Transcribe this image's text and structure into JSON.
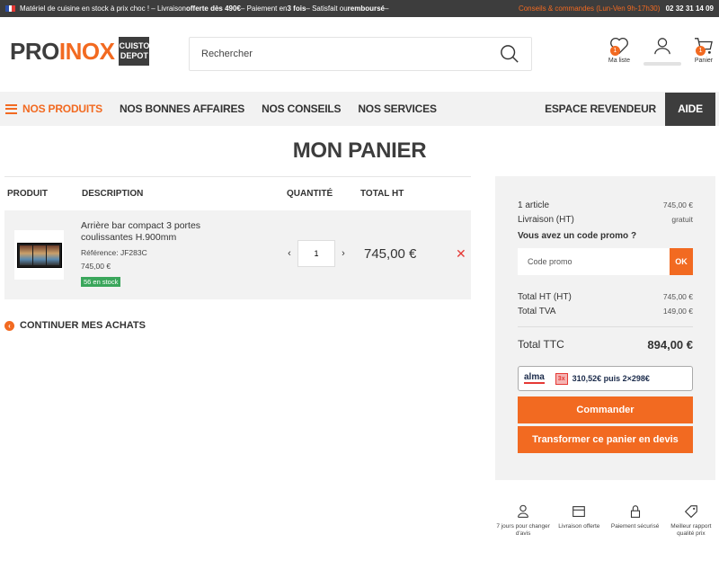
{
  "topbar": {
    "message_parts": [
      "Matériel de cuisine en stock à prix choc ! – Livraison ",
      "offerte dès 490€",
      " – Paiement en ",
      "3 fois",
      " – Satisfait ou ",
      "remboursé",
      " –"
    ],
    "contact": "Conseils & commandes (Lun-Ven 9h-17h30)",
    "phone": "02 32 31 14 09"
  },
  "logo": {
    "pro": "PRO",
    "inox": "INOX",
    "badge_line1": "CUISTO",
    "badge_line2": "DEPOT"
  },
  "search": {
    "placeholder": "Rechercher"
  },
  "header_icons": {
    "wishlist_label": "Ma liste",
    "wishlist_count": "1",
    "cart_label": "Panier",
    "cart_count": "1"
  },
  "nav": {
    "products": "NOS PRODUITS",
    "deals": "NOS BONNES AFFAIRES",
    "advice": "NOS CONSEILS",
    "services": "NOS SERVICES",
    "reseller": "ESPACE REVENDEUR",
    "help": "AIDE"
  },
  "page_title": "MON PANIER",
  "cart": {
    "headers": {
      "product": "PRODUIT",
      "description": "DESCRIPTION",
      "quantity": "QUANTITÉ",
      "total": "TOTAL HT"
    },
    "items": [
      {
        "name": "Arrière bar compact 3 portes coulissantes H.900mm",
        "reference": "Référence: JF283C",
        "unit_price": "745,00 €",
        "stock": "56 en stock",
        "quantity": "1",
        "total": "745,00 €"
      }
    ],
    "continue": "CONTINUER MES ACHATS"
  },
  "summary": {
    "articles_label": "1 article",
    "articles_value": "745,00 €",
    "shipping_label": "Livraison (HT)",
    "shipping_value": "gratuit",
    "promo_question": "Vous avez un code promo ?",
    "promo_placeholder": "Code promo",
    "promo_button": "OK",
    "total_ht_label": "Total HT (HT)",
    "total_ht_value": "745,00 €",
    "tva_label": "Total TVA",
    "tva_value": "149,00 €",
    "ttc_label": "Total TTC",
    "ttc_value": "894,00 €",
    "alma_logo": "alma",
    "alma_badge": "3x",
    "alma_text": "310,52€ puis 2×298€",
    "order_button": "Commander",
    "quote_button": "Transformer ce panier en devis"
  },
  "reassurance": [
    {
      "icon": "person-return-icon",
      "text": "7 jours pour changer d'avis"
    },
    {
      "icon": "box-icon",
      "text": "Livraison offerte"
    },
    {
      "icon": "lock-icon",
      "text": "Paiement sécurisé"
    },
    {
      "icon": "tag-icon",
      "text": "Meilleur rapport qualité prix"
    }
  ],
  "colors": {
    "accent": "#f26a21",
    "dark": "#3d3d3d",
    "stock": "#3aa65b",
    "remove": "#e53935"
  }
}
